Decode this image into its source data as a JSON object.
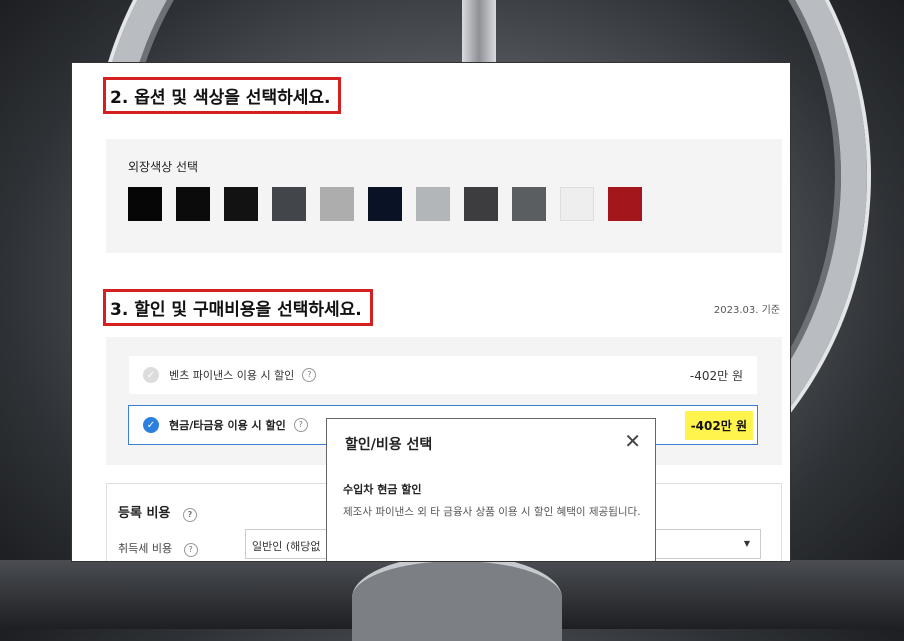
{
  "step2": {
    "title": "2. 옵션 및 색상을 선택하세요."
  },
  "exterior": {
    "label": "외장색상 선택",
    "colors": [
      "#060606",
      "#0b0b0b",
      "#121212",
      "#42454a",
      "#adadad",
      "#0a1226",
      "#b3b6b9",
      "#3d3d3f",
      "#5b5e61",
      "#eeeeee",
      "#a3161b"
    ]
  },
  "step3": {
    "title": "3. 할인 및 구매비용을 선택하세요.",
    "base_date": "2023.03. 기준"
  },
  "discounts": [
    {
      "label": "벤츠 파이낸스 이용 시 할인",
      "help": "?",
      "price": "-402만 원",
      "selected": false
    },
    {
      "label": "현금/타금융 이용 시 할인",
      "help": "?",
      "price": "-402만 원",
      "selected": true
    }
  ],
  "registration": {
    "title": "등록 비용",
    "help": "?",
    "row_label": "취득세 비용",
    "row_help": "?",
    "select_value": "일반인 (해당없"
  },
  "modal": {
    "title": "할인/비용 선택",
    "close": "✕",
    "subtitle": "수입차 현금 할인",
    "description": "제조사 파이낸스 외 타 금융사 상품 이용 시 할인 혜택이 제공됩니다."
  }
}
